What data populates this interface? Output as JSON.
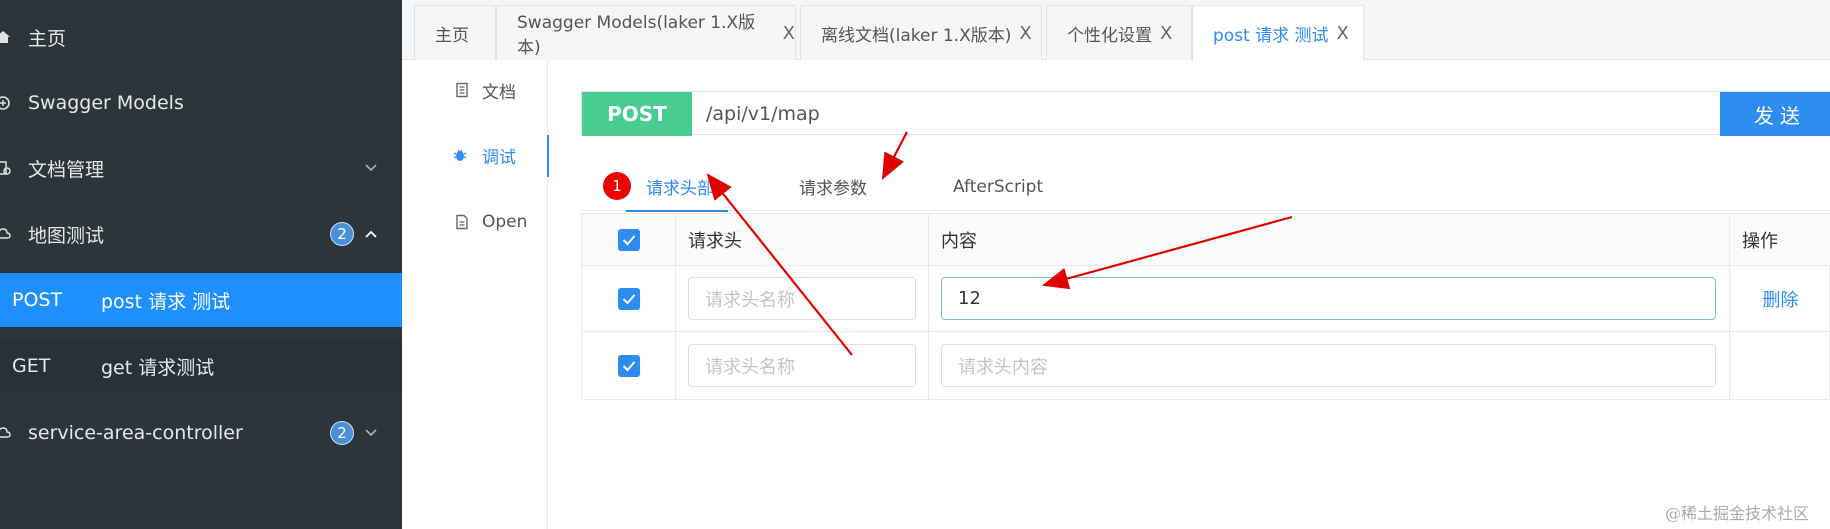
{
  "sidebar": {
    "items": [
      {
        "label": "主页",
        "icon": "home-icon"
      },
      {
        "label": "Swagger Models",
        "icon": "models-icon"
      },
      {
        "label": "文档管理",
        "icon": "doc-settings-icon"
      },
      {
        "label": "地图测试",
        "icon": "cloud-icon",
        "badge": "2"
      },
      {
        "label": "service-area-controller",
        "icon": "cloud-icon",
        "badge": "2"
      }
    ],
    "sub_items": [
      {
        "method": "POST",
        "name": "post 请求 测试"
      },
      {
        "method": "GET",
        "name": "get 请求测试"
      }
    ]
  },
  "tabs": [
    {
      "label": "主页"
    },
    {
      "label": "Swagger Models(laker 1.X版本)",
      "close": "X"
    },
    {
      "label": "离线文档(laker 1.X版本)",
      "close": "X"
    },
    {
      "label": "个性化设置",
      "close": "X"
    },
    {
      "label": "post 请求 测试",
      "close": "X"
    }
  ],
  "vmenu": [
    {
      "label": "文档",
      "icon": "document-icon"
    },
    {
      "label": "调试",
      "icon": "bug-icon"
    },
    {
      "label": "Open",
      "icon": "file-icon"
    }
  ],
  "request": {
    "method": "POST",
    "url": "/api/v1/map",
    "send_label": "发送"
  },
  "subtabs": [
    {
      "label": "请求头部",
      "badge": "1"
    },
    {
      "label": "请求参数"
    },
    {
      "label": "AfterScript"
    }
  ],
  "table": {
    "headers": [
      "请求头",
      "内容",
      "操作"
    ],
    "rows": [
      {
        "name_placeholder": "请求头名称",
        "value": "12",
        "action": "删除"
      },
      {
        "name_placeholder": "请求头名称",
        "value_placeholder": "请求头内容"
      }
    ]
  },
  "watermark": "@稀土掘金技术社区",
  "colors": {
    "sidebar_bg": "#2c353a",
    "accent": "#2d8cf0",
    "post_green": "#49cc90",
    "annotation_red": "#e00000"
  }
}
